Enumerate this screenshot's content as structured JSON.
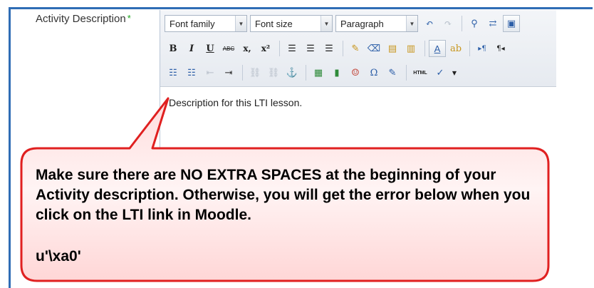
{
  "field": {
    "label": "Activity Description",
    "required_mark": "*"
  },
  "toolbar": {
    "font_family": "Font family",
    "font_size": "Font size",
    "paragraph": "Paragraph",
    "bold": "B",
    "italic": "I",
    "underline": "U",
    "strikethrough": "ABC",
    "subscript": "x,",
    "superscript": "x²",
    "html_label": "HTML",
    "omega": "Ω"
  },
  "editor": {
    "content": "Description for this LTI lesson."
  },
  "callout": {
    "message": "Make sure there are NO EXTRA SPACES at the beginning of your Activity description. Otherwise, you will get the error below when you click on the LTI link in Moodle.",
    "error_code": "u'\\xa0'"
  },
  "colors": {
    "frame": "#2f6db5",
    "callout_fill": "#ffe6e6",
    "callout_border": "#e02020"
  }
}
